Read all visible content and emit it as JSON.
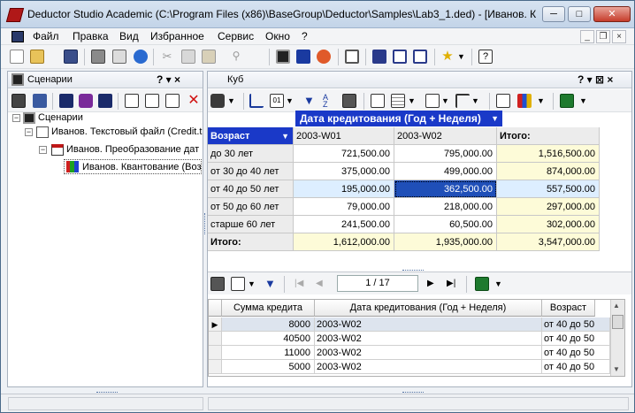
{
  "window": {
    "title": "Deductor Studio Academic (C:\\Program Files (x86)\\BaseGroup\\Deductor\\Samples\\Lab3_1.ded) - [Иванов. К...",
    "min": "─",
    "max": "□",
    "close": "✕"
  },
  "menu": [
    "Файл",
    "Правка",
    "Вид",
    "Избранное",
    "Сервис",
    "Окно",
    "?"
  ],
  "mdi": {
    "min": "_",
    "restore": "❐",
    "close": "×"
  },
  "left_panel": {
    "title": "Сценарии",
    "ctrl": "? ▾ ×",
    "tree": [
      {
        "label": "Сценарии",
        "expander": "−"
      },
      {
        "label": "Иванов. Текстовый файл (Credit.t",
        "expander": "−"
      },
      {
        "label": "Иванов. Преобразование дат",
        "expander": "−"
      },
      {
        "label": "Иванов. Квантование (Воз",
        "expander": ""
      }
    ]
  },
  "right_panel": {
    "title": "Куб",
    "ctrl": "? ▾ ⊠ ×"
  },
  "cube": {
    "column_dim": "Дата кредитования (Год + Неделя)",
    "row_dim": "Возраст",
    "col_headers": [
      "2003-W01",
      "2003-W02",
      "Итого:"
    ],
    "rows": [
      {
        "label": "до 30 лет",
        "v": [
          "721,500.00",
          "795,000.00",
          "1,516,500.00"
        ]
      },
      {
        "label": "от 30 до 40 лет",
        "v": [
          "375,000.00",
          "499,000.00",
          "874,000.00"
        ]
      },
      {
        "label": "от 40 до 50 лет",
        "v": [
          "195,000.00",
          "362,500.00",
          "557,500.00"
        ]
      },
      {
        "label": "от 50 до 60 лет",
        "v": [
          "79,000.00",
          "218,000.00",
          "297,000.00"
        ]
      },
      {
        "label": "старше 60 лет",
        "v": [
          "241,500.00",
          "60,500.00",
          "302,000.00"
        ]
      }
    ],
    "total_row": {
      "label": "Итого:",
      "v": [
        "1,612,000.00",
        "1,935,000.00",
        "3,547,000.00"
      ]
    }
  },
  "details": {
    "page": "1 / 17",
    "columns": [
      "Сумма кредита",
      "Дата кредитования (Год + Неделя)",
      "Возраст"
    ],
    "rows": [
      [
        "8000",
        "2003-W02",
        "от 40 до 50"
      ],
      [
        "40500",
        "2003-W02",
        "от 40 до 50"
      ],
      [
        "11000",
        "2003-W02",
        "от 40 до 50"
      ],
      [
        "5000",
        "2003-W02",
        "от 40 до 50"
      ]
    ]
  },
  "colors": {
    "accent": "#1a39c8",
    "selected": "#1f4fb8",
    "total": "#fdfbd8",
    "row_sel": "#ddeeff"
  }
}
